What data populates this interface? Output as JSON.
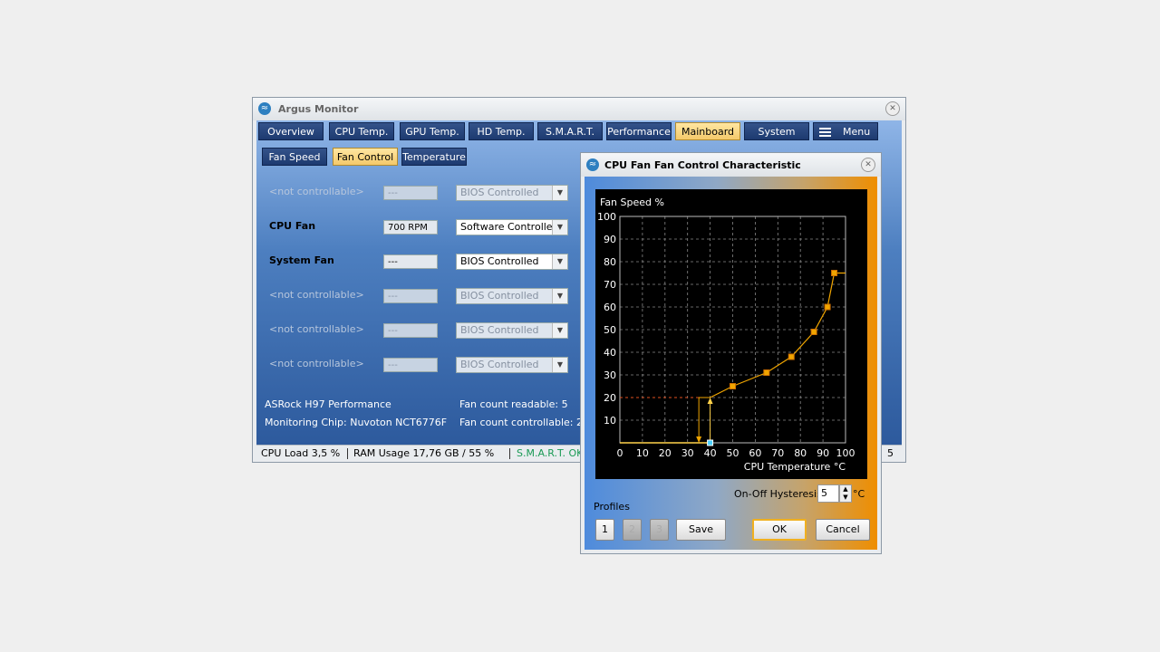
{
  "main_window": {
    "title": "Argus Monitor",
    "tabs": [
      {
        "label": "Overview",
        "active": false
      },
      {
        "label": "CPU Temp.",
        "active": false
      },
      {
        "label": "GPU Temp.",
        "active": false
      },
      {
        "label": "HD Temp.",
        "active": false
      },
      {
        "label": "S.M.A.R.T.",
        "active": false
      },
      {
        "label": "Performance",
        "active": false
      },
      {
        "label": "Mainboard",
        "active": true
      },
      {
        "label": "System",
        "active": false
      },
      {
        "label": "Menu",
        "active": false
      }
    ],
    "subtabs": [
      {
        "label": "Fan Speed",
        "active": false
      },
      {
        "label": "Fan Control",
        "active": true
      },
      {
        "label": "Temperature",
        "active": false
      }
    ],
    "fans": [
      {
        "name": "<not controllable>",
        "rpm": "---",
        "mode": "BIOS Controlled",
        "enabled": false
      },
      {
        "name": "CPU Fan",
        "rpm": "700 RPM",
        "mode": "Software Controlled",
        "enabled": true
      },
      {
        "name": "System Fan",
        "rpm": "---",
        "mode": "BIOS Controlled",
        "enabled": true
      },
      {
        "name": "<not controllable>",
        "rpm": "---",
        "mode": "BIOS Controlled",
        "enabled": false
      },
      {
        "name": "<not controllable>",
        "rpm": "---",
        "mode": "BIOS Controlled",
        "enabled": false
      },
      {
        "name": "<not controllable>",
        "rpm": "---",
        "mode": "BIOS Controlled",
        "enabled": false
      }
    ],
    "board": "ASRock H97 Performance",
    "chip": "Monitoring Chip: Nuvoton NCT6776F",
    "fan_readable": "Fan count readable: 5",
    "fan_controllable": "Fan count controllable: 2",
    "status": {
      "cpu_load": "CPU Load 3,5 %",
      "ram_usage": "RAM Usage 17,76 GB / 55 %",
      "smart": "S.M.A.R.T. OK",
      "tail": "5"
    }
  },
  "dialog": {
    "title": "CPU Fan Fan Control Characteristic",
    "hysteresis_label": "On-Off Hysteresis",
    "hysteresis_value": "5",
    "hysteresis_unit": "°C",
    "profiles_label": "Profiles",
    "profile_buttons": [
      "1",
      "2",
      "3"
    ],
    "save_label": "Save",
    "ok_label": "OK",
    "cancel_label": "Cancel"
  },
  "chart_data": {
    "type": "line",
    "ylabel": "Fan Speed %",
    "xlabel": "CPU Temperature °C",
    "xlim": [
      0,
      100
    ],
    "ylim": [
      0,
      100
    ],
    "xticks": [
      0,
      10,
      20,
      30,
      40,
      50,
      60,
      70,
      80,
      90,
      100
    ],
    "yticks": [
      10,
      20,
      30,
      40,
      50,
      60,
      70,
      80,
      90,
      100
    ],
    "grid": true,
    "points": [
      {
        "x": 40,
        "y": 20
      },
      {
        "x": 50,
        "y": 25
      },
      {
        "x": 65,
        "y": 31
      },
      {
        "x": 76,
        "y": 38
      },
      {
        "x": 86,
        "y": 49
      },
      {
        "x": 92,
        "y": 60
      },
      {
        "x": 95,
        "y": 75
      },
      {
        "x": 100,
        "y": 75
      }
    ],
    "off_point": {
      "x": 40,
      "y": 0
    },
    "hysteresis_x": 35,
    "off_level_y": 0,
    "hysteresis_level_y": 20,
    "colors": {
      "curve": "#f0a500",
      "grid": "#888888",
      "hysteresis": "#e05020",
      "marker_edge": "#d07000",
      "off_marker": "#4ad0ff"
    }
  }
}
